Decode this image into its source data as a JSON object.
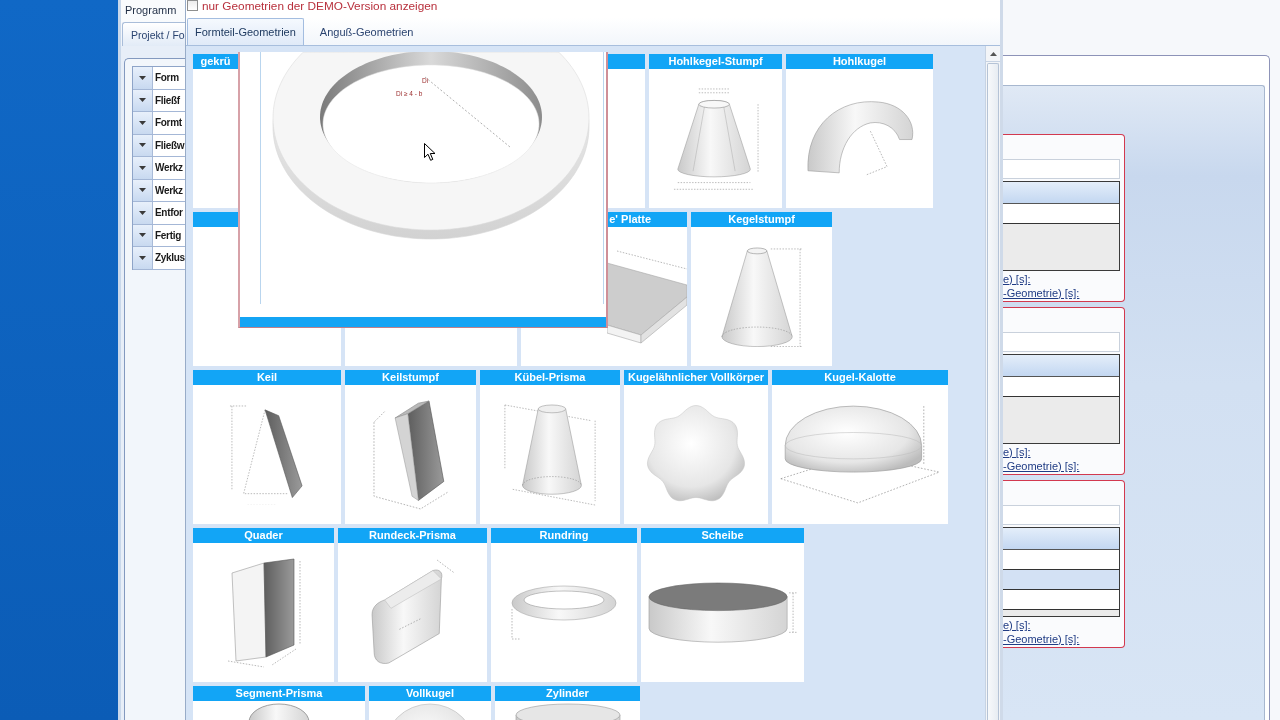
{
  "main_window": {
    "menu_tab": "Programm",
    "tab": {
      "label": "Projekt / Fo",
      "selected": true
    },
    "sections": [
      "Form",
      "Fließf",
      "Formt",
      "Fließw",
      "Werkz",
      "Werkz",
      "Entfor",
      "Fertig",
      "Zyklus"
    ],
    "groups": [
      {
        "rows": [
          {
            "shaded": false
          }
        ],
        "links": [
          "e) [s]:",
          "-Geometrie) [s]:"
        ]
      },
      {
        "rows": [
          {
            "shaded": false
          }
        ],
        "links": [
          "e) [s]:",
          "-Geometrie) [s]:"
        ]
      },
      {
        "rows": [
          {
            "shaded": false
          },
          {
            "shaded": true
          },
          {
            "shaded": false
          }
        ],
        "links": [
          "e) [s]:",
          "-Geometrie) [s]:"
        ]
      }
    ]
  },
  "dialog": {
    "demo_filter": {
      "label": "nur Geometrien der DEMO-Version anzeigen",
      "checked": false
    },
    "tabs": [
      {
        "label": "Formteil-Geometrien",
        "selected": true
      },
      {
        "label": "Anguß-Geometrien",
        "selected": false
      }
    ],
    "card_rows": [
      {
        "cards": [
          {
            "title": "gekrü",
            "kind": "blank"
          },
          {
            "kind": "blank"
          },
          {
            "title": "Hohlkegel-Stumpf",
            "kind": "hollow-frustum"
          },
          {
            "title": "Hohlkugel",
            "kind": "hollow-sphere"
          }
        ]
      },
      {
        "cards": [
          {
            "kind": "blank"
          },
          {
            "kind": "blank"
          },
          {
            "title": "e' Platte",
            "kind": "plate"
          },
          {
            "title": "Kegelstumpf",
            "kind": "frustum"
          }
        ]
      },
      {
        "cards": [
          {
            "title": "Keil",
            "kind": "wedge"
          },
          {
            "title": "Keilstumpf",
            "kind": "wedge-frustum"
          },
          {
            "title": "Kübel-Prisma",
            "kind": "bucket-prism"
          },
          {
            "title": "Kugelähnlicher Vollkörper",
            "kind": "blob"
          },
          {
            "title": "Kugel-Kalotte",
            "kind": "dome"
          }
        ]
      },
      {
        "cards": [
          {
            "title": "Quader",
            "kind": "cuboid"
          },
          {
            "title": "Rundeck-Prisma",
            "kind": "rounded-prism"
          },
          {
            "title": "Rundring",
            "kind": "torus"
          },
          {
            "title": "Scheibe",
            "kind": "disc"
          }
        ]
      },
      {
        "cards": [
          {
            "title": "Segment-Prisma",
            "kind": "segment-prism"
          },
          {
            "title": "Vollkugel",
            "kind": "sphere"
          },
          {
            "title": "Zylinder",
            "kind": "cylinder"
          }
        ]
      }
    ],
    "preview": {
      "labels": [
        "Di",
        "Di ≥ 4 - b"
      ]
    }
  }
}
